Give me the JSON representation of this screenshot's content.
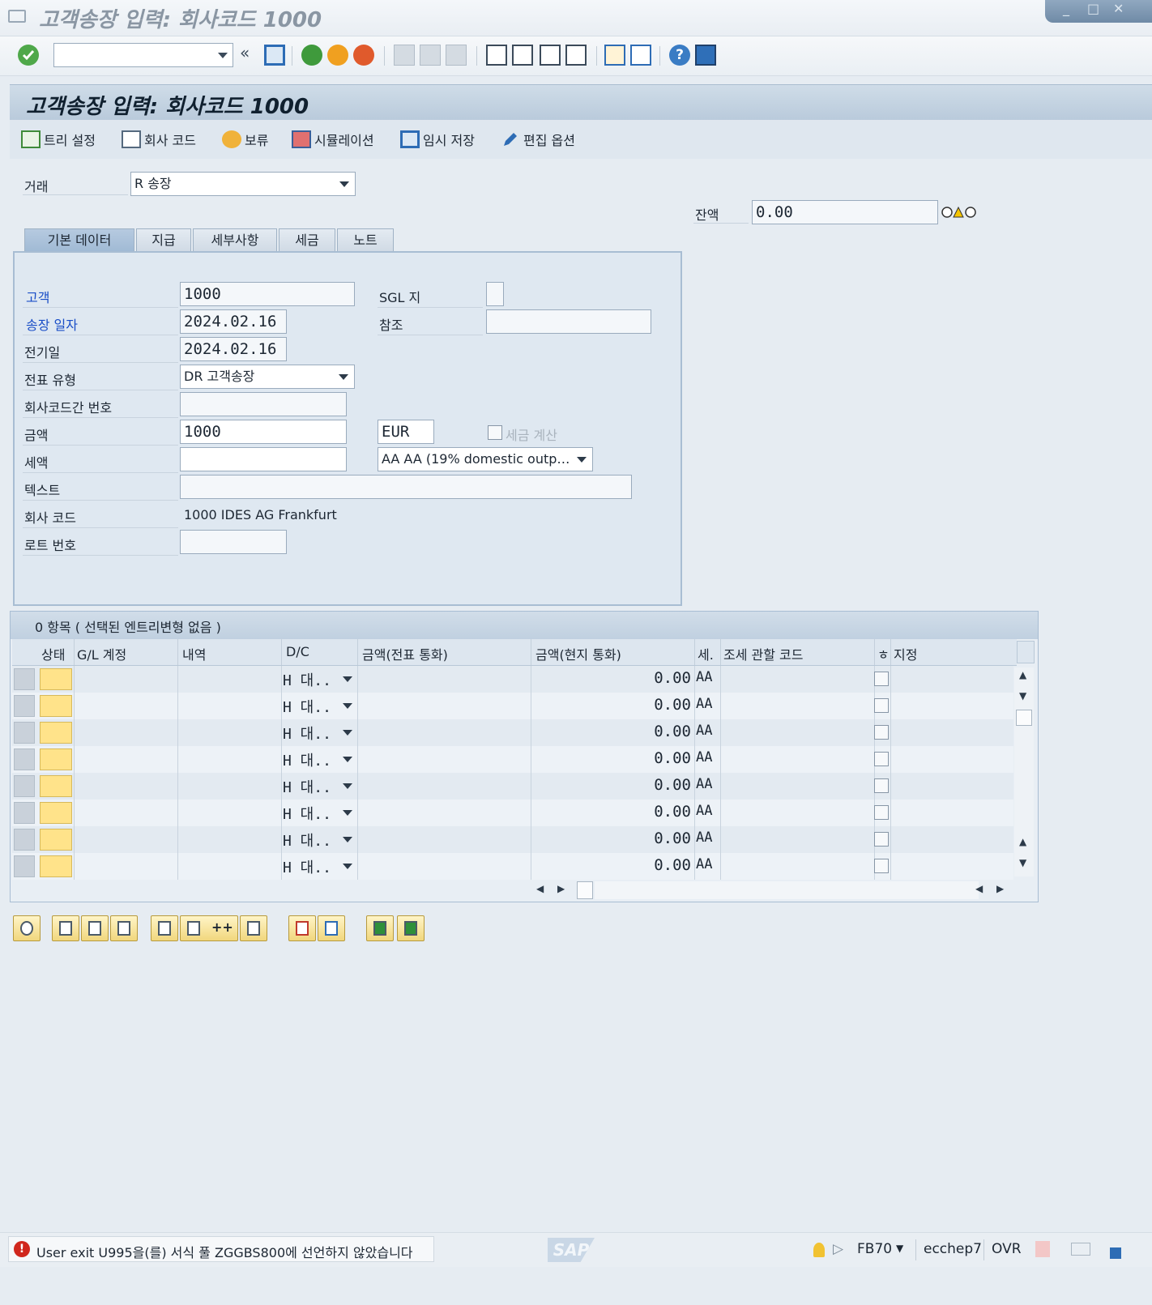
{
  "window": {
    "title": "고객송장 입력: 회사코드 1000",
    "controls": [
      "_",
      "□",
      "✕"
    ]
  },
  "std_toolbar": {
    "command_value": "",
    "icons": [
      "enter-icon",
      "back-icon",
      "save-icon",
      "back-green-icon",
      "exit-icon",
      "cancel-icon",
      "print-icon",
      "find-icon",
      "find-next-icon",
      "first-page-icon",
      "prev-page-icon",
      "next-page-icon",
      "last-page-icon",
      "new-session-icon",
      "shortcut-icon",
      "help-icon",
      "customize-layout-icon"
    ]
  },
  "screen": {
    "title": "고객송장 입력: 회사코드 1000"
  },
  "app_toolbar": [
    {
      "label": "트리 설정",
      "icon": "tree-icon"
    },
    {
      "label": "회사 코드",
      "icon": "company-code-icon"
    },
    {
      "label": "보류",
      "icon": "hold-icon"
    },
    {
      "label": "시뮬레이션",
      "icon": "simulate-icon"
    },
    {
      "label": "임시 저장",
      "icon": "park-icon"
    },
    {
      "label": "편집 옵션",
      "icon": "pencil-icon"
    }
  ],
  "transaction": {
    "label": "거래",
    "value": "R 송장"
  },
  "balance": {
    "label": "잔액",
    "value": "0.00",
    "status": "warning"
  },
  "tabs": [
    "기본 데이터",
    "지급",
    "세부사항",
    "세금",
    "노트"
  ],
  "basic_data": {
    "customer": {
      "label": "고객",
      "value": "1000"
    },
    "invoice_date": {
      "label": "송장 일자",
      "value": "2024.02.16"
    },
    "posting_date": {
      "label": "전기일",
      "value": "2024.02.16"
    },
    "doc_type": {
      "label": "전표 유형",
      "value": "DR 고객송장"
    },
    "cross_cc": {
      "label": "회사코드간 번호",
      "value": ""
    },
    "amount": {
      "label": "금액",
      "value": "1000",
      "currency": "EUR"
    },
    "calc_tax": {
      "label": "세금 계산",
      "checked": false
    },
    "tax_amount": {
      "label": "세액",
      "value": "",
      "tax_code": "AA AA (19% domestic outp…"
    },
    "text": {
      "label": "텍스트",
      "value": ""
    },
    "company_code": {
      "label": "회사 코드",
      "value": "1000 IDES AG Frankfurt"
    },
    "lot_number": {
      "label": "로트 번호",
      "value": ""
    },
    "sgl": {
      "label": "SGL 지",
      "value": ""
    },
    "reference": {
      "label": "참조",
      "value": ""
    }
  },
  "items_table": {
    "caption": "0 항목 ( 선택된 엔트리변형 없음 )",
    "columns": [
      "상태",
      "G/L 계정",
      "내역",
      "D/C",
      "금액(전표 통화)",
      "금액(현지 통화)",
      "세.",
      "조세 관할 코드",
      "ㅎ",
      "지정"
    ],
    "rows": [
      {
        "gl": "",
        "desc": "",
        "dc": "H  대..",
        "amt_doc": "",
        "amt_local": "0.00",
        "tax": "AA",
        "jur": "",
        "assign": ""
      },
      {
        "gl": "",
        "desc": "",
        "dc": "H  대..",
        "amt_doc": "",
        "amt_local": "0.00",
        "tax": "AA",
        "jur": "",
        "assign": ""
      },
      {
        "gl": "",
        "desc": "",
        "dc": "H  대..",
        "amt_doc": "",
        "amt_local": "0.00",
        "tax": "AA",
        "jur": "",
        "assign": ""
      },
      {
        "gl": "",
        "desc": "",
        "dc": "H  대..",
        "amt_doc": "",
        "amt_local": "0.00",
        "tax": "AA",
        "jur": "",
        "assign": ""
      },
      {
        "gl": "",
        "desc": "",
        "dc": "H  대..",
        "amt_doc": "",
        "amt_local": "0.00",
        "tax": "AA",
        "jur": "",
        "assign": ""
      },
      {
        "gl": "",
        "desc": "",
        "dc": "H  대..",
        "amt_doc": "",
        "amt_local": "0.00",
        "tax": "AA",
        "jur": "",
        "assign": ""
      },
      {
        "gl": "",
        "desc": "",
        "dc": "H  대..",
        "amt_doc": "",
        "amt_local": "0.00",
        "tax": "AA",
        "jur": "",
        "assign": ""
      },
      {
        "gl": "",
        "desc": "",
        "dc": "H  대..",
        "amt_doc": "",
        "amt_local": "0.00",
        "tax": "AA",
        "jur": "",
        "assign": ""
      }
    ]
  },
  "table_toolbar": {
    "icons": [
      "details-icon",
      "select-all-icon",
      "select-block-icon",
      "deselect-icon",
      "insert-row-icon",
      "append-rows-icon",
      "delete-row-icon",
      "copy-icon",
      "paste-icon",
      "sort-icon",
      "filter-icon"
    ],
    "append_label": "++"
  },
  "status_bar": {
    "message": "User exit U995을(를) 서식 풀 ZGGBS800에 선언하지 않았습니다",
    "message_type": "error",
    "logo": "SAP",
    "transaction": "FB70",
    "server": "ecchep7",
    "mode": "OVR"
  }
}
